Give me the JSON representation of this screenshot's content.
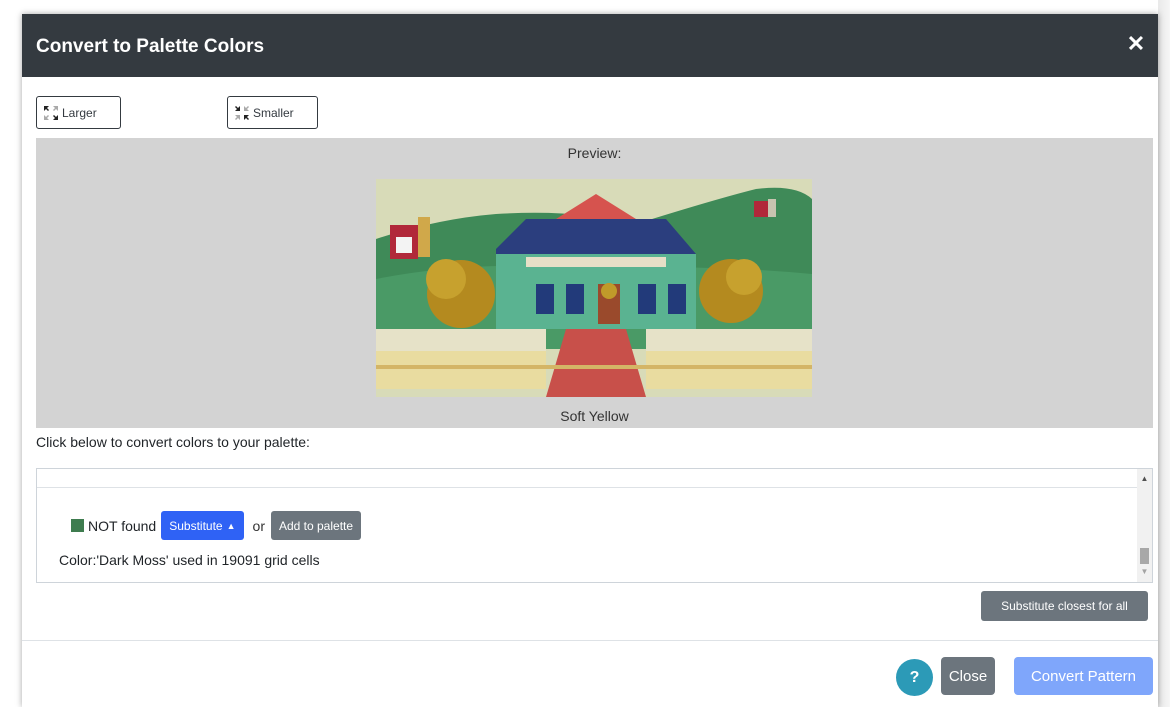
{
  "dialog": {
    "title": "Convert to Palette Colors"
  },
  "size_controls": {
    "larger_label": "Larger",
    "smaller_label": "Smaller"
  },
  "preview": {
    "label": "Preview:",
    "caption": "Soft Yellow"
  },
  "instructions": "Click below to convert colors to your palette:",
  "color_entry": {
    "swatch_color": "#3e7c4f",
    "status_text": "NOT found",
    "substitute_label": "Substitute",
    "or_text": "or",
    "add_label": "Add to palette",
    "usage_text": "Color:'Dark Moss' used in 19091 grid cells"
  },
  "substitute_all_label": "Substitute closest for all",
  "footer": {
    "help_label": "?",
    "close_label": "Close",
    "convert_label": "Convert Pattern"
  },
  "colors": {
    "header_bg": "#343a40",
    "primary": "#2f62f5",
    "secondary": "#6c757d",
    "info": "#2c9ab7",
    "primary_disabled": "#7fa6fb"
  }
}
